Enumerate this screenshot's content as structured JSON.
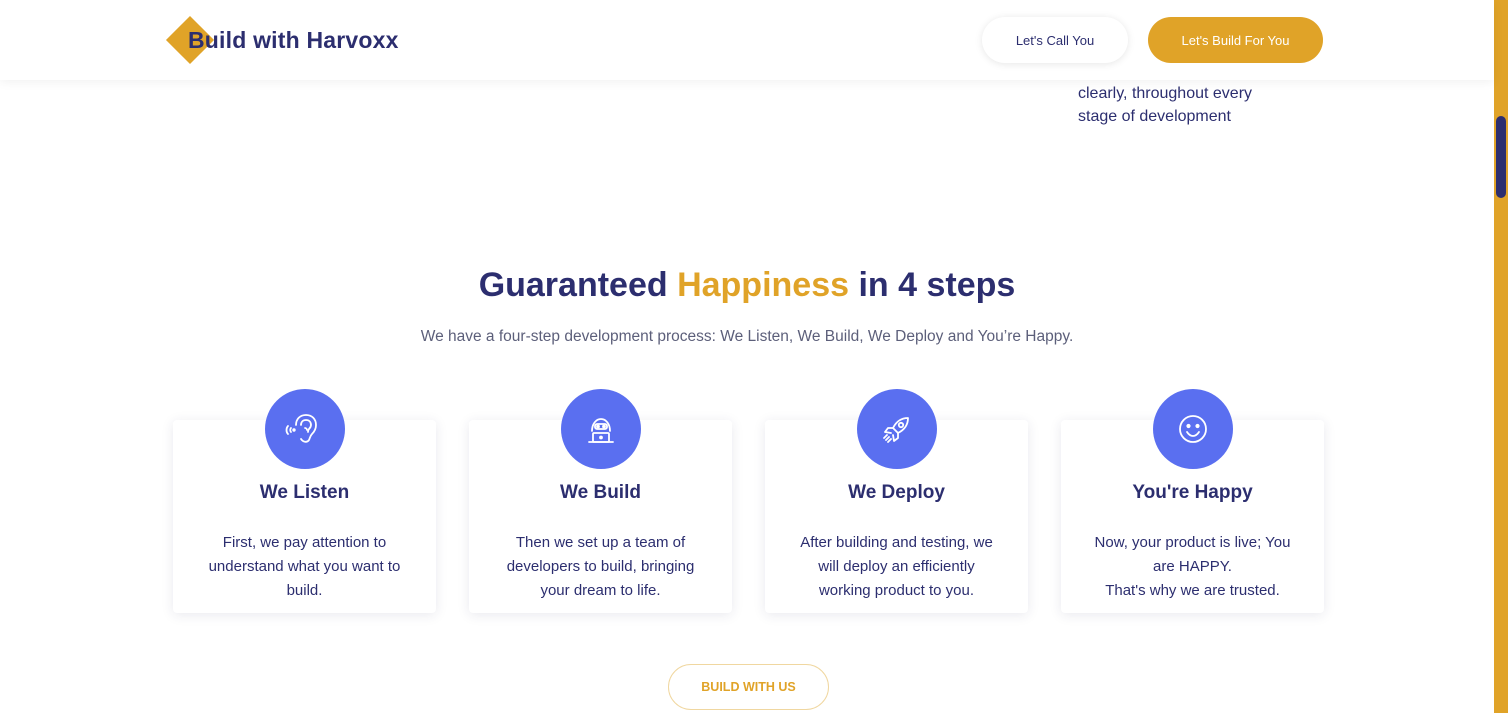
{
  "header": {
    "logo_text": "Build with Harvoxx",
    "call_button": "Let's Call You",
    "build_button": "Let's Build For You"
  },
  "previous_section": {
    "lines": [
      "clearly, throughout every",
      "stage of development"
    ]
  },
  "steps_section": {
    "title_part1": "Guaranteed ",
    "title_accent": "Happiness",
    "title_part2": " in 4 steps",
    "subtitle": "We have a four-step development process: We Listen, We Build, We Deploy and You’re Happy.",
    "cards": [
      {
        "icon": "ear-icon",
        "title": "We Listen",
        "lines": [
          "First, we pay attention to",
          "understand what you want to",
          "build."
        ]
      },
      {
        "icon": "developer-laptop-icon",
        "title": "We Build",
        "lines": [
          "Then we set up a team of",
          "developers to build, bringing",
          "your dream to life."
        ]
      },
      {
        "icon": "rocket-icon",
        "title": "We Deploy",
        "lines": [
          "After building and testing, we",
          "will deploy an efficiently",
          "working product to you."
        ]
      },
      {
        "icon": "smiley-icon",
        "title": "You're Happy",
        "lines": [
          "Now, your product is live; You",
          "are HAPPY.",
          "That's why we are trusted."
        ]
      }
    ],
    "cta_button": "BUILD WITH US"
  },
  "colors": {
    "navy": "#2c2e6f",
    "gold": "#e0a328",
    "icon_blue": "#5a6ff0"
  }
}
